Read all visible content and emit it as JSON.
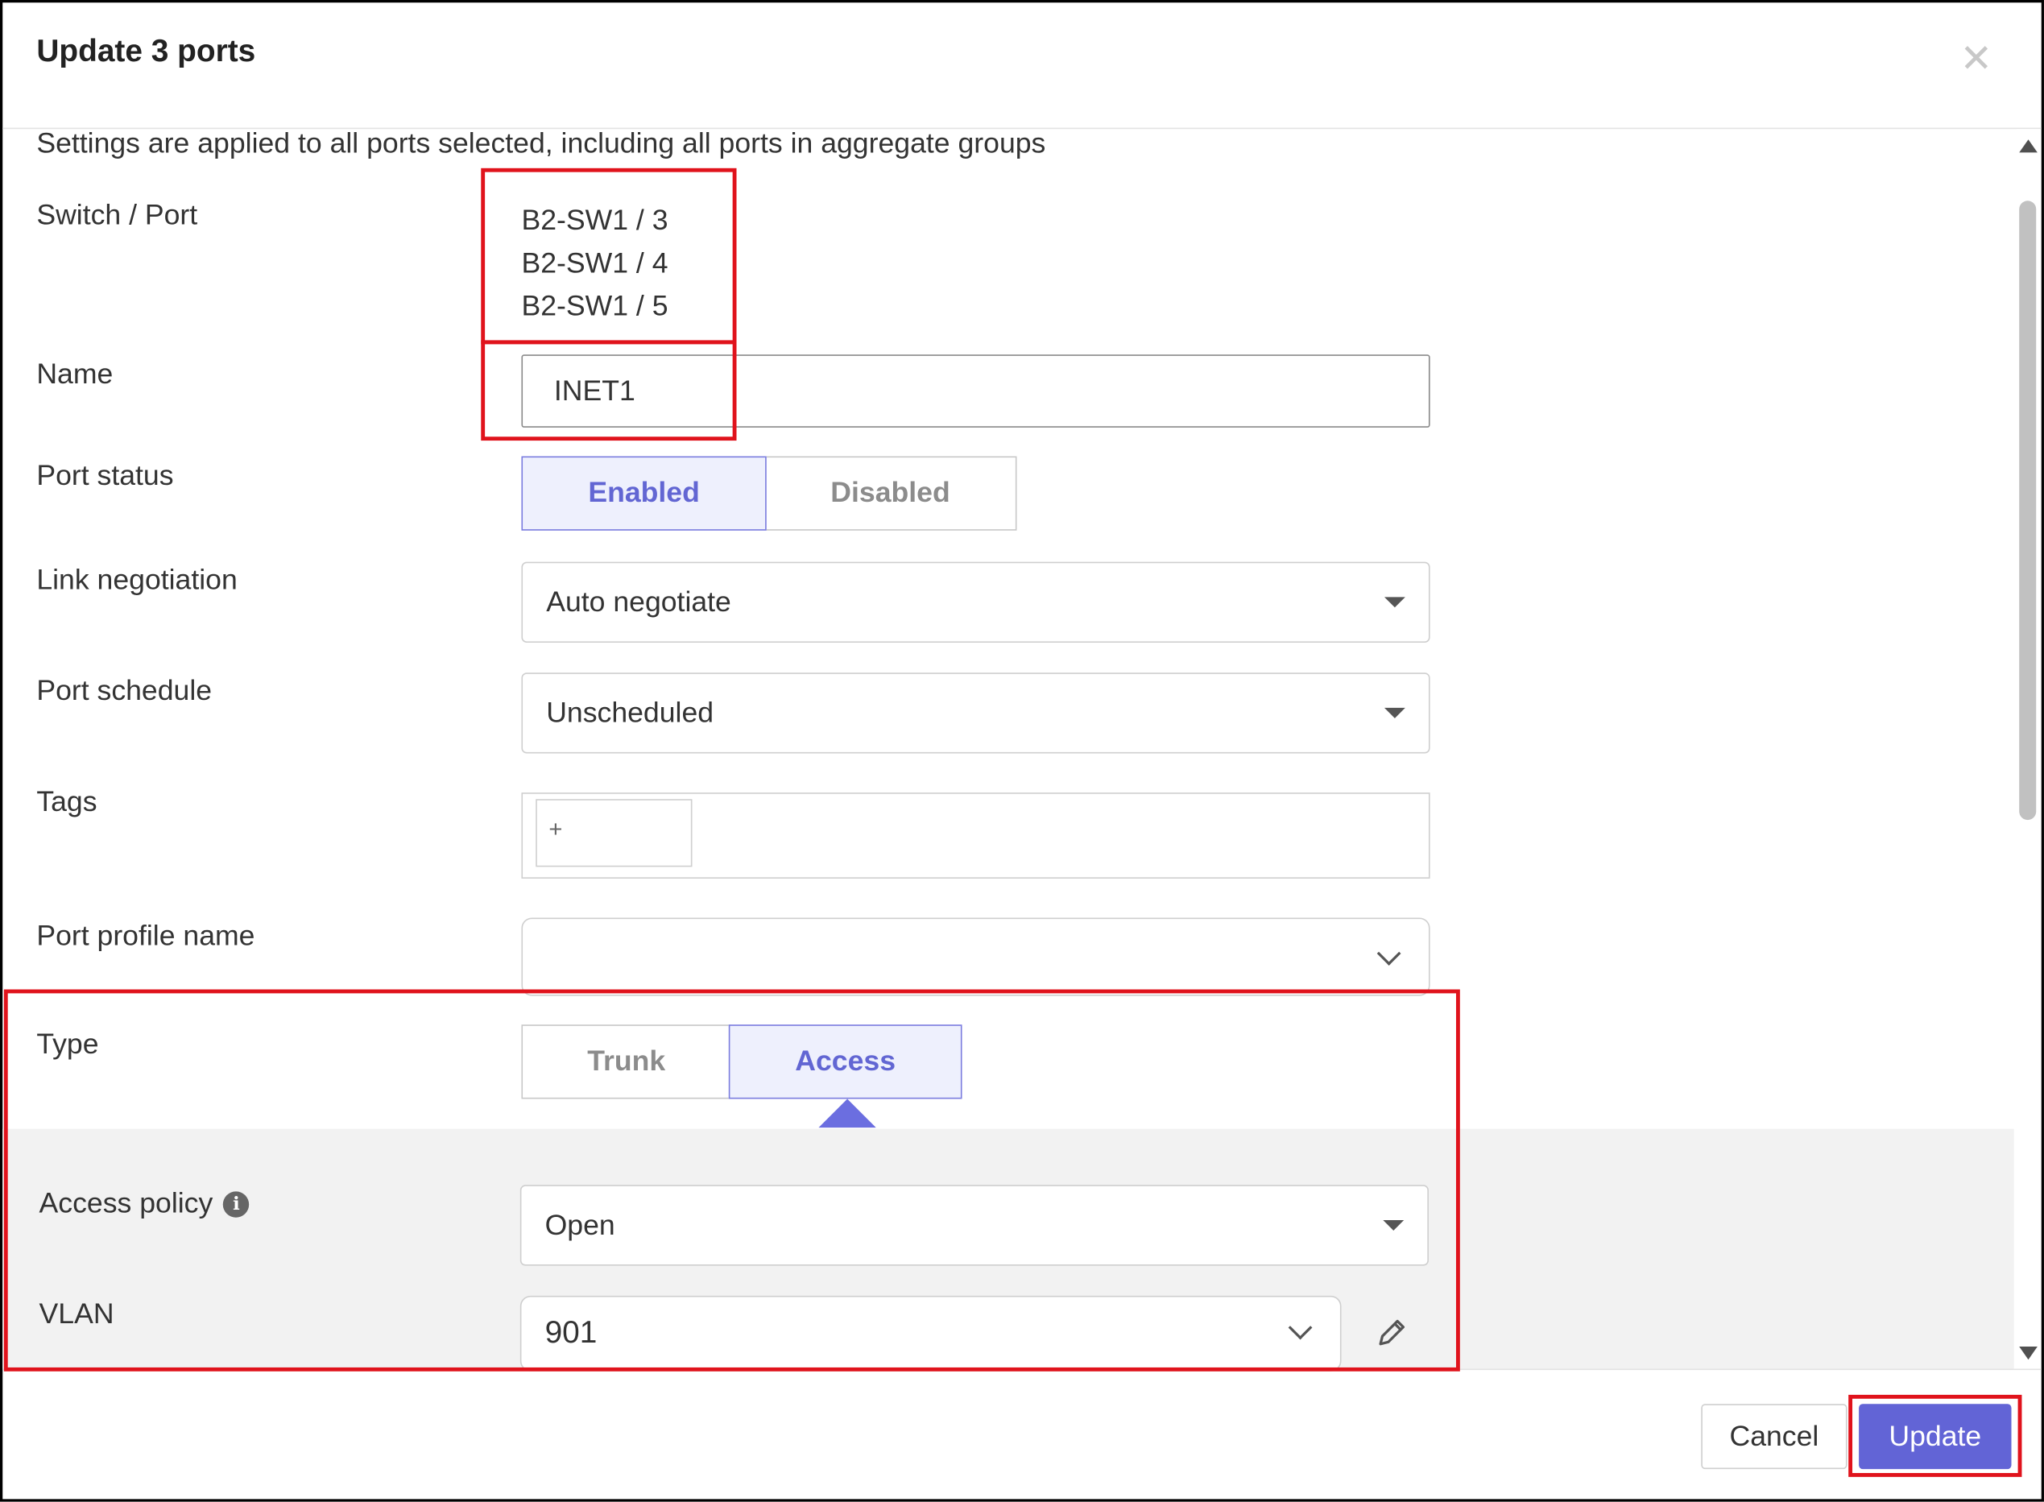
{
  "dialog": {
    "title": "Update 3 ports",
    "close_icon": "close-icon",
    "intro": "Settings are applied to all ports selected, including all ports in aggregate groups"
  },
  "form": {
    "switch_port": {
      "label": "Switch / Port",
      "values": [
        "B2-SW1 / 3",
        "B2-SW1 / 4",
        "B2-SW1 / 5"
      ]
    },
    "name": {
      "label": "Name",
      "value": "INET1"
    },
    "port_status": {
      "label": "Port status",
      "options": [
        "Enabled",
        "Disabled"
      ],
      "selected": "Enabled"
    },
    "link_negotiation": {
      "label": "Link negotiation",
      "value": "Auto negotiate"
    },
    "port_schedule": {
      "label": "Port schedule",
      "value": "Unscheduled"
    },
    "tags": {
      "label": "Tags",
      "add_label": "+"
    },
    "port_profile_name": {
      "label": "Port profile name",
      "value": ""
    },
    "type": {
      "label": "Type",
      "options": [
        "Trunk",
        "Access"
      ],
      "selected": "Access"
    },
    "access_policy": {
      "label": "Access policy",
      "info_icon": "info-icon",
      "value": "Open"
    },
    "vlan": {
      "label": "VLAN",
      "value": "901",
      "edit_icon": "pencil-icon"
    }
  },
  "footer": {
    "cancel": "Cancel",
    "update": "Update"
  },
  "colors": {
    "accent": "#6264d6",
    "highlight": "#e0131c",
    "active_bg": "#eef0fd"
  }
}
